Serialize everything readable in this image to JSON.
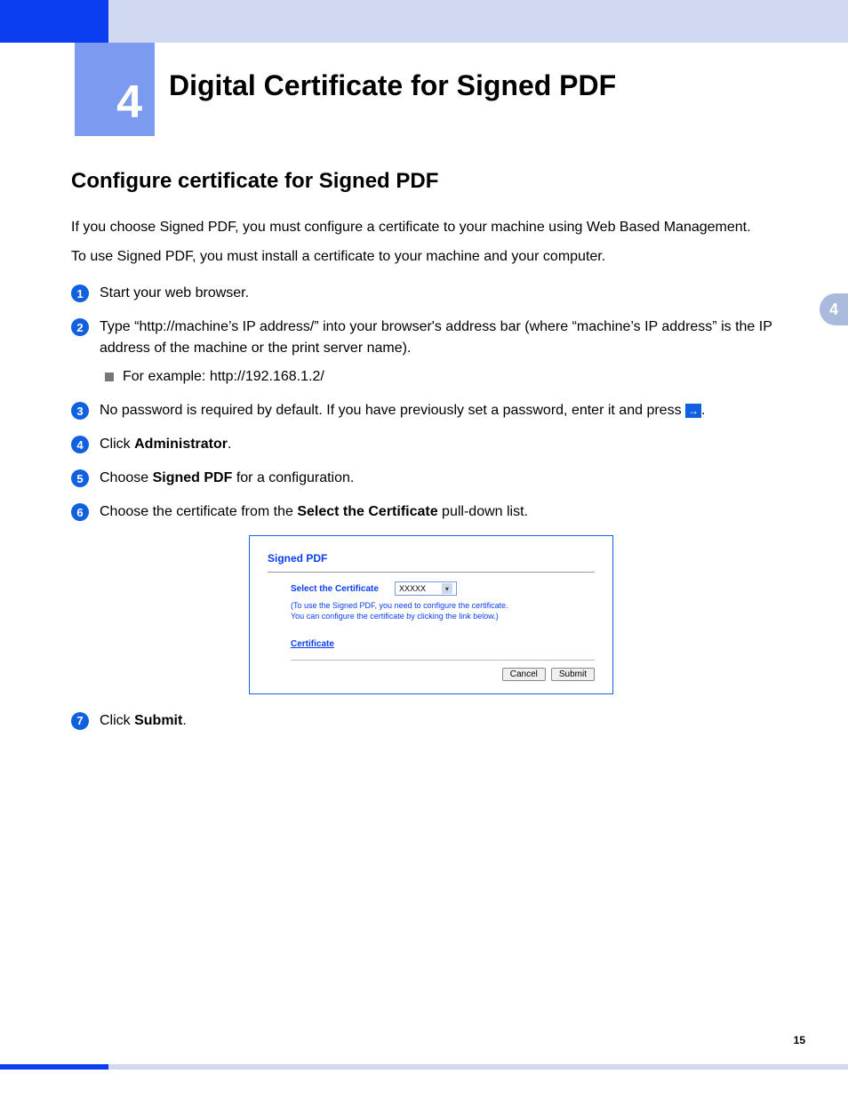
{
  "chapter_number": "4",
  "chapter_title": "Digital Certificate for Signed PDF",
  "side_tab": "4",
  "section_title": "Configure certificate for Signed PDF",
  "intro_para1": "If you choose Signed PDF, you must configure a certificate to your machine using Web Based Management.",
  "intro_para2": "To use Signed PDF, you must install a certificate to your machine and your computer.",
  "steps": {
    "s1": "Start your web browser.",
    "s2a": "Type “http://machine’s IP address/” into your browser's address bar (where “machine’s IP address” is the IP address of the machine or the print server name).",
    "s2_sub": "For example: http://192.168.1.2/",
    "s3a": "No password is required by default. If you have previously set a password, enter it and press ",
    "s3b": ".",
    "s4a": "Click ",
    "s4b": "Administrator",
    "s4c": ".",
    "s5a": "Choose ",
    "s5b": "Signed PDF",
    "s5c": " for a configuration.",
    "s6a": "Choose the certificate from the ",
    "s6b": "Select the Certificate",
    "s6c": " pull-down list.",
    "s7a": "Click ",
    "s7b": "Submit",
    "s7c": "."
  },
  "screenshot": {
    "title": "Signed PDF",
    "select_label": "Select the Certificate",
    "select_value": "XXXXX",
    "note_line1": "(To use the Signed PDF, you need to configure the certificate.",
    "note_line2": "You can configure the certificate by clicking the link below.)",
    "link": "Certificate",
    "cancel": "Cancel",
    "submit": "Submit"
  },
  "page_number": "15",
  "arrow_glyph": "→"
}
